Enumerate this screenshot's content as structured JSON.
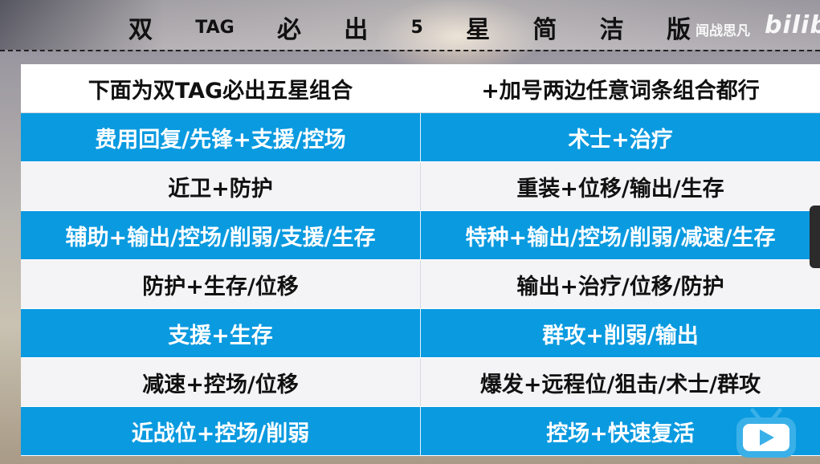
{
  "title": {
    "chars": [
      "双",
      "TAG",
      "必",
      "出",
      "5",
      "星",
      "简",
      "洁",
      "版"
    ]
  },
  "watermark": {
    "author": "闻战思凡",
    "logo": "bilibili"
  },
  "table": {
    "header": [
      "下面为双TAG必出五星组合",
      "+加号两边任意词条组合都行"
    ],
    "rows": [
      [
        "费用回复/先锋+支援/控场",
        "术士+治疗"
      ],
      [
        "近卫+防护",
        "重装+位移/输出/生存"
      ],
      [
        "辅助+输出/控场/削弱/支援/生存",
        "特种+输出/控场/削弱/减速/生存"
      ],
      [
        "防护+生存/位移",
        "输出+治疗/位移/防护"
      ],
      [
        "支援+生存",
        "群攻+削弱/输出"
      ],
      [
        "减速+控场/位移",
        "爆发+远程位/狙击/术士/群攻"
      ],
      [
        "近战位+控场/削弱",
        "控场+快速复活"
      ]
    ]
  },
  "colors": {
    "blue_row": "#0a9ae0",
    "white_row": "#f4f4f6",
    "tv_icon": "#3ab0e8"
  },
  "icons": [
    "bilibili-tv-icon"
  ]
}
